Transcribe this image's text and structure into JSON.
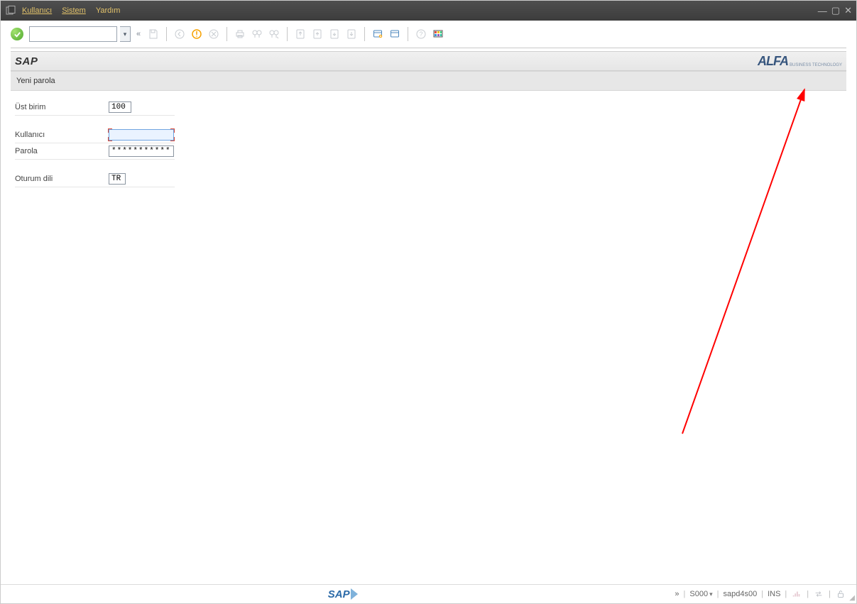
{
  "menu": {
    "user": "Kullanıcı",
    "system": "Sistem",
    "help": "Yardım"
  },
  "page": {
    "title": "SAP",
    "subtitle": "Yeni parola",
    "brand": "ALFA"
  },
  "form": {
    "client_label": "Üst birim",
    "client_value": "100",
    "user_label": "Kullanıcı",
    "user_value": "",
    "password_label": "Parola",
    "password_value": "************",
    "lang_label": "Oturum dili",
    "lang_value": "TR"
  },
  "status": {
    "tcode": "S000",
    "system": "sapd4s00",
    "mode": "INS"
  },
  "glyph": {
    "dblchev": "«",
    "drop": "▾",
    "min": "—",
    "max": "▢",
    "close": "✕",
    "chev": "»"
  }
}
